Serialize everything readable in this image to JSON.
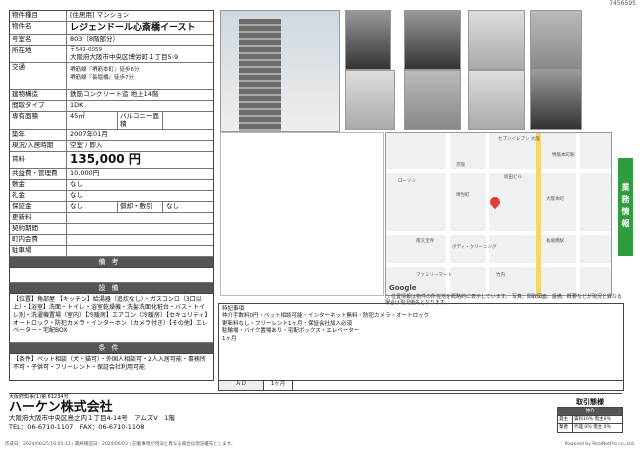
{
  "doc_id": "7456595",
  "property": {
    "rows": [
      {
        "label": "物件種目",
        "value": "[住居用] マンション"
      },
      {
        "label": "物件名",
        "value": "レジェンドール心斎橋イースト"
      },
      {
        "label": "号室名",
        "value": "803（8階部分）"
      },
      {
        "label": "所在地",
        "sub": "〒541-0059",
        "value": "大阪府大阪市中央区博労町１丁目5-9"
      },
      {
        "label": "交通",
        "value": "堺筋線『堺筋本町』徒歩6分",
        "value2": "堺筋線『長堀橋』徒歩7分"
      },
      {
        "label": "建物構造",
        "value": "鉄筋コンクリート造 地上14階"
      }
    ],
    "layout_label": "間取タイプ",
    "layout": "1DK",
    "area_label": "専有面積",
    "area": "45㎡",
    "balcony_label": "バルコニー面積",
    "balcony": "",
    "built_label": "築年",
    "built": "2007年01月",
    "status_label": "現況/入居時期",
    "status": "空室 / 即入",
    "rent_label": "賃料",
    "rent": "135,000 円",
    "fee_label": "共益費・管理費",
    "fee": "10,000円",
    "deposit_label": "敷金",
    "deposit": "なし",
    "key_label": "礼金",
    "key": "なし",
    "hoshokin_label": "保証金",
    "hoshokin": "なし",
    "shokyaku_label": "償却・敷引",
    "shokyaku": "なし",
    "blank_labels": [
      "更新料",
      "契約期間",
      "町内会費",
      "駐車場"
    ],
    "remarks_head": "備考",
    "equipment_head": "設備",
    "equipment": "【位置】角部屋 【キッチン】給湯器（追炊なし）・ガスコンロ（3口以上）・【浴室】洗面・トイレ・浴室乾燥機・洗髪洗面化粧台・バス・トイレ別・洗濯機置場（室内）【冷暖房】エアコン（冷暖房）【セキュリティ】オートロック・防犯カメラ・インターホン（カメラ付き）【その他】エレベーター・宅配BOX",
    "conditions_head": "条件",
    "conditions": "【条件】ペット相談（犬・猫可）・外国人相談可・2人入居可能・事務所不可・子供可・フリーレント・保証会社利用可能"
  },
  "map": {
    "labels": [
      "セブンイレブン 大阪",
      "堺筋本町駅",
      "ローソン",
      "京阪",
      "坂田ビル",
      "博労町",
      "南久宝寺",
      "大阪本町",
      "ボディ・クリーニング",
      "長堀橋駅",
      "竹内",
      "ファミリーマート"
    ],
    "note": "○ 位置情報は物件の所在地を概略的に表示しています。 写真、間取図面、設備、概要などが現況と異なる場合は現況優先となります。"
  },
  "remarks": {
    "text": "特記事項\n仲介手数料0円・ペット相談可能・インターネット無料・防犯カメラ・オートロック\n更新料なし・フリーレント1ヶ月・保証会社加入必須\n駐輪場・バイク置場あり・宅配ボックス・エレベーター\n1ヶ月",
    "foot_key": "ＡＤ",
    "foot_val": "1ヶ月"
  },
  "side_tab": "業務情報",
  "company": {
    "license": "大阪府知事(1)第 61234号",
    "name": "ハーケン株式会社",
    "address": "大阪府大阪市中央区島之内１丁目4-14号　アムズV　1階",
    "tel": "TEL：06-6710-1107　FAX：06-6710-1108"
  },
  "transaction": {
    "title": "取引態様",
    "head": "仲介",
    "row1": [
      "貸主",
      "賃料10％ 借主0％"
    ],
    "row2": [
      "業者",
      "代理 0％ 借主 0％"
    ]
  },
  "footer": "作成日：2024/06/25 16:05:13 / 最終確認日：2024/06/03 | 記載事項が現況と異なる場合は現況優先とします。",
  "powered": "Powered by RealNetPro co.,Ltd."
}
